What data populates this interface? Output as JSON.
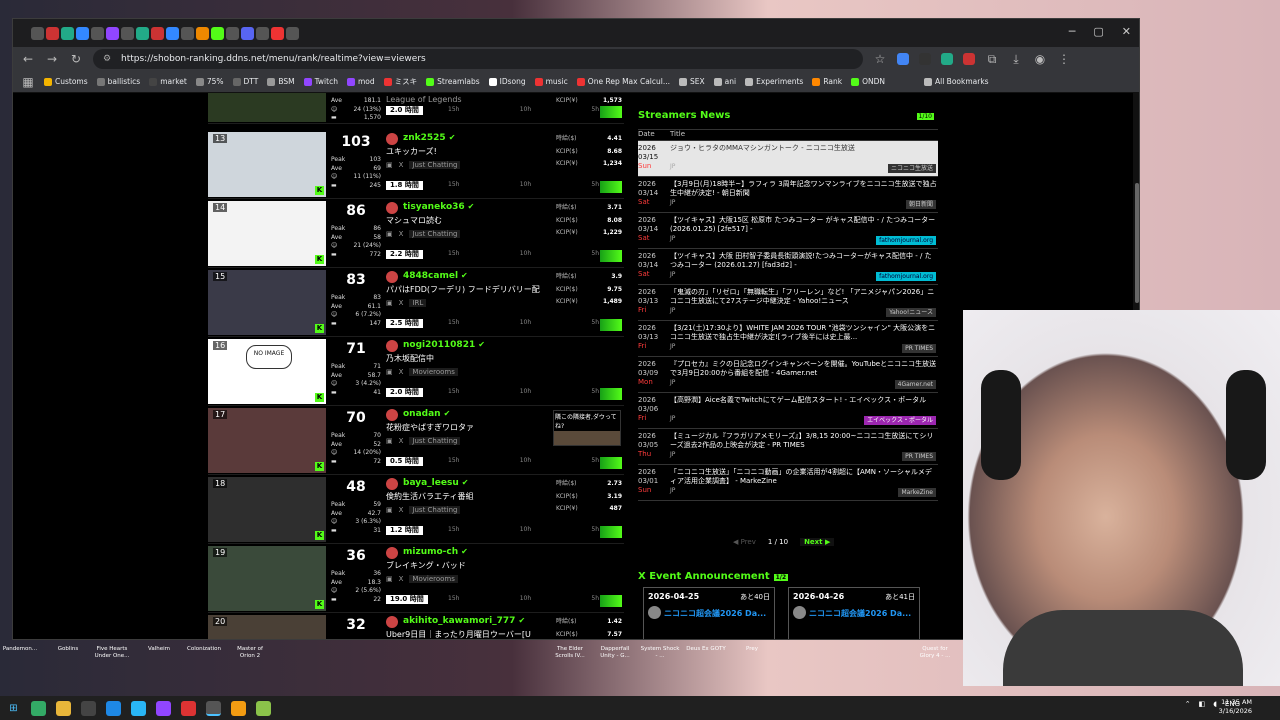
{
  "browser": {
    "url": "https://shobon-ranking.ddns.net/menu/rank/realtime?view=viewers",
    "bookmarks": [
      "Customs",
      "ballistics",
      "market",
      "75%",
      "DTT",
      "BSM",
      "Twitch",
      "mod",
      "ミスキ",
      "Streamlabs",
      "IDsong",
      "music",
      "One Rep Max Calcul...",
      "SEX",
      "ani",
      "Experiments",
      "Rank",
      "ONDN"
    ],
    "all_bookmarks": "All Bookmarks"
  },
  "ranking": {
    "axis": [
      "15h",
      "10h",
      "5h"
    ],
    "top_partial": {
      "ave_label": "Ave",
      "ave": "181.1",
      "peak_sub": "24 (13%)",
      "total": "1,570",
      "title": "League of Legends",
      "kcip_label": "KCIP(¥)",
      "kcip": "1,573",
      "time": "2.0 時間"
    },
    "items": [
      {
        "rank": "13",
        "viewers": "103",
        "peak": "103",
        "ave": "69",
        "sub": "11 (11%)",
        "total": "245",
        "name": "znk2525",
        "title": "ユキッカーズ!",
        "category": "Just Chatting",
        "hourly": "4.41",
        "usd": "8.68",
        "kcip": "1,234",
        "time": "1.8 時間",
        "label_hourly": "時給($)",
        "label_usd": "KCIP($)",
        "label_kcip": "KCIP(¥)"
      },
      {
        "rank": "14",
        "viewers": "86",
        "peak": "86",
        "ave": "58",
        "sub": "21 (24%)",
        "total": "772",
        "name": "tisyaneko36",
        "title": "マシュマロ読む",
        "category": "Just Chatting",
        "hourly": "3.71",
        "usd": "8.08",
        "kcip": "1,229",
        "time": "2.2 時間",
        "label_hourly": "時給($)",
        "label_usd": "KCIP($)",
        "label_kcip": "KCIP(¥)"
      },
      {
        "rank": "15",
        "viewers": "83",
        "peak": "83",
        "ave": "61.1",
        "sub": "6 (7.2%)",
        "total": "147",
        "name": "4848camel",
        "title": "パパはFDD(フーデリ) フードデリバリー配",
        "category": "IRL",
        "hourly": "3.9",
        "usd": "9.75",
        "kcip": "1,489",
        "time": "2.5 時間",
        "label_hourly": "時給($)",
        "label_usd": "KCIP($)",
        "label_kcip": "KCIP(¥)"
      },
      {
        "rank": "16",
        "viewers": "71",
        "peak": "71",
        "ave": "58.7",
        "sub": "3 (4.2%)",
        "total": "41",
        "name": "nogi20110821",
        "title": "乃木坂配信中",
        "category": "Movierooms",
        "hourly": "",
        "usd": "",
        "kcip": "",
        "time": "2.0 時間",
        "label_hourly": "",
        "label_usd": "",
        "label_kcip": ""
      },
      {
        "rank": "17",
        "viewers": "70",
        "peak": "70",
        "ave": "52",
        "sub": "14 (20%)",
        "total": "72",
        "name": "onadan",
        "title": "花粉症やばすぎワロタァ",
        "category": "Just Chatting",
        "hourly": "",
        "usd": "",
        "kcip": "",
        "time": "0.5 時間",
        "label_hourly": "",
        "label_usd": "",
        "label_kcip": ""
      },
      {
        "rank": "18",
        "viewers": "48",
        "peak": "59",
        "ave": "42.7",
        "sub": "3 (6.3%)",
        "total": "31",
        "name": "baya_leesu",
        "title": "倹約生活バラエティ番組",
        "category": "Just Chatting",
        "hourly": "2.73",
        "usd": "3.19",
        "kcip": "487",
        "time": "1.2 時間",
        "label_hourly": "時給($)",
        "label_usd": "KCIP($)",
        "label_kcip": "KCIP(¥)"
      },
      {
        "rank": "19",
        "viewers": "36",
        "peak": "36",
        "ave": "18.3",
        "sub": "2 (5.6%)",
        "total": "22",
        "name": "mizumo-ch",
        "title": "ブレイキング・バッド",
        "category": "Movierooms",
        "hourly": "",
        "usd": "",
        "kcip": "",
        "time": "19.0 時間",
        "label_hourly": "",
        "label_usd": "",
        "label_kcip": ""
      },
      {
        "rank": "20",
        "viewers": "32",
        "peak": "",
        "ave": "",
        "sub": "",
        "total": "",
        "name": "akihito_kawamori_777",
        "title": "Uber9日目｜まったり月曜日ウーバー[U",
        "category": "",
        "hourly": "1.42",
        "usd": "7.57",
        "kcip": "",
        "time": "",
        "label_hourly": "時給($)",
        "label_usd": "KCIP($)",
        "label_kcip": ""
      }
    ],
    "peak_label": "Peak",
    "ave_label": "Ave",
    "no_image": "NO IMAGE",
    "popup_text": "隣この隣接者,ダウってね?"
  },
  "news": {
    "heading": "Streamers News",
    "page_badge": "1/10",
    "col_date": "Date",
    "col_title": "Title",
    "rows": [
      {
        "year": "2026",
        "md": "03/15",
        "dow": "Sun",
        "title": "ジョウ・ヒラタのMMAマシンガントーク - ニコニコ生放送",
        "src": "ニコニコ生放送",
        "lang": "JP"
      },
      {
        "year": "2026",
        "md": "03/14",
        "dow": "Sat",
        "title": "【3月9日(月)18時半~】ラフィラ 3周年記念ワンマンライブをニコニコ生放送で独占生中継が決定! - 朝日新聞",
        "src": "朝日新聞",
        "lang": "JP"
      },
      {
        "year": "2026",
        "md": "03/14",
        "dow": "Sat",
        "title": "【ツイキャス】大阪15区 松原市 たつみコーター がキャス配信中 - / たつみコーター (2026.01.25) [2fe517] -",
        "src": "fathomjournal.org",
        "lang": "JP"
      },
      {
        "year": "2026",
        "md": "03/14",
        "dow": "Sat",
        "title": "【ツイキャス】大阪 田村智子委員長街頭演説!たつみコーターがキャス配信中 - / たつみコーター (2026.01.27) [fad3d2] -",
        "src": "fathomjournal.org",
        "lang": "JP"
      },
      {
        "year": "2026",
        "md": "03/13",
        "dow": "Fri",
        "title": "「鬼滅の刃」「リゼロ」「無職転生」「フリーレン」など! 「アニメジャパン2026」ニコニコ生放送にて27ステージ中継決定 - Yahoo!ニュース",
        "src": "Yahoo!ニュース",
        "lang": "JP"
      },
      {
        "year": "2026",
        "md": "03/13",
        "dow": "Fri",
        "title": "【3/21(土)17:30より】WHITE JAM 2026 TOUR \"池袋ツンシャイン\" 大阪公演をニコニコ生放送で独占生中継が決定![ライブ後半には史上最...",
        "src": "PR TIMES",
        "lang": "JP"
      },
      {
        "year": "2026",
        "md": "03/09",
        "dow": "Mon",
        "title": "『プロセカ』ミクの日記念ログインキャンペーンを開催。YouTubeとニコニコ生放送で3月9日20:00から番組を配信 - 4Gamer.net",
        "src": "4Gamer.net",
        "lang": "JP"
      },
      {
        "year": "2026",
        "md": "03/06",
        "dow": "Fri",
        "title": "【高野潤】Aice名義でTwitchにてゲーム配信スタート! - エイベックス・ポータル",
        "src": "エイベックス・ポータル",
        "lang": "JP"
      },
      {
        "year": "2026",
        "md": "03/05",
        "dow": "Thu",
        "title": "【ミュージカル『フラガリアメモリーズ』】3/8,15 20:00~ニコニコ生放送にてシリーズ過去2作品の上映会が決定 - PR TIMES",
        "src": "PR TIMES",
        "lang": "JP"
      },
      {
        "year": "2026",
        "md": "03/01",
        "dow": "Sun",
        "title": "「ニコニコ生放送」「ニコニコ動画」の企業活用が4割超に【AMN・ソーシャルメディア活用企業調査】 - MarkeZine",
        "src": "MarkeZine",
        "lang": "JP"
      }
    ],
    "prev": "◀ Prev",
    "page": "1 / 10",
    "next": "Next ▶"
  },
  "xevents": {
    "heading": "X Event Announcement",
    "badge": "1/2",
    "cards": [
      {
        "date": "2026-04-25",
        "remain": "あと40日",
        "title": "ニコニコ超会議2026 Da..."
      },
      {
        "date": "2026-04-26",
        "remain": "あと41日",
        "title": "ニコニコ超会議2026 Da..."
      }
    ]
  },
  "desktop": {
    "icons": [
      "Pandemon...",
      "Goblins",
      "Five Hearts Under One...",
      "Valheim",
      "Colonization",
      "Master of Orion 2",
      "The Elder Scrolls IV...",
      "Dapperfall Unity - G...",
      "System Shock - ...",
      "Deus Ex GOTY",
      "Prey",
      "Quest for Glory 4 - ..."
    ]
  },
  "taskbar": {
    "lang": "ENG",
    "time": "11:35 AM",
    "date": "3/16/2026"
  },
  "colors": {
    "accent": "#53fc18",
    "news_sat": "#ff3b3b",
    "link": "#2196f3"
  }
}
